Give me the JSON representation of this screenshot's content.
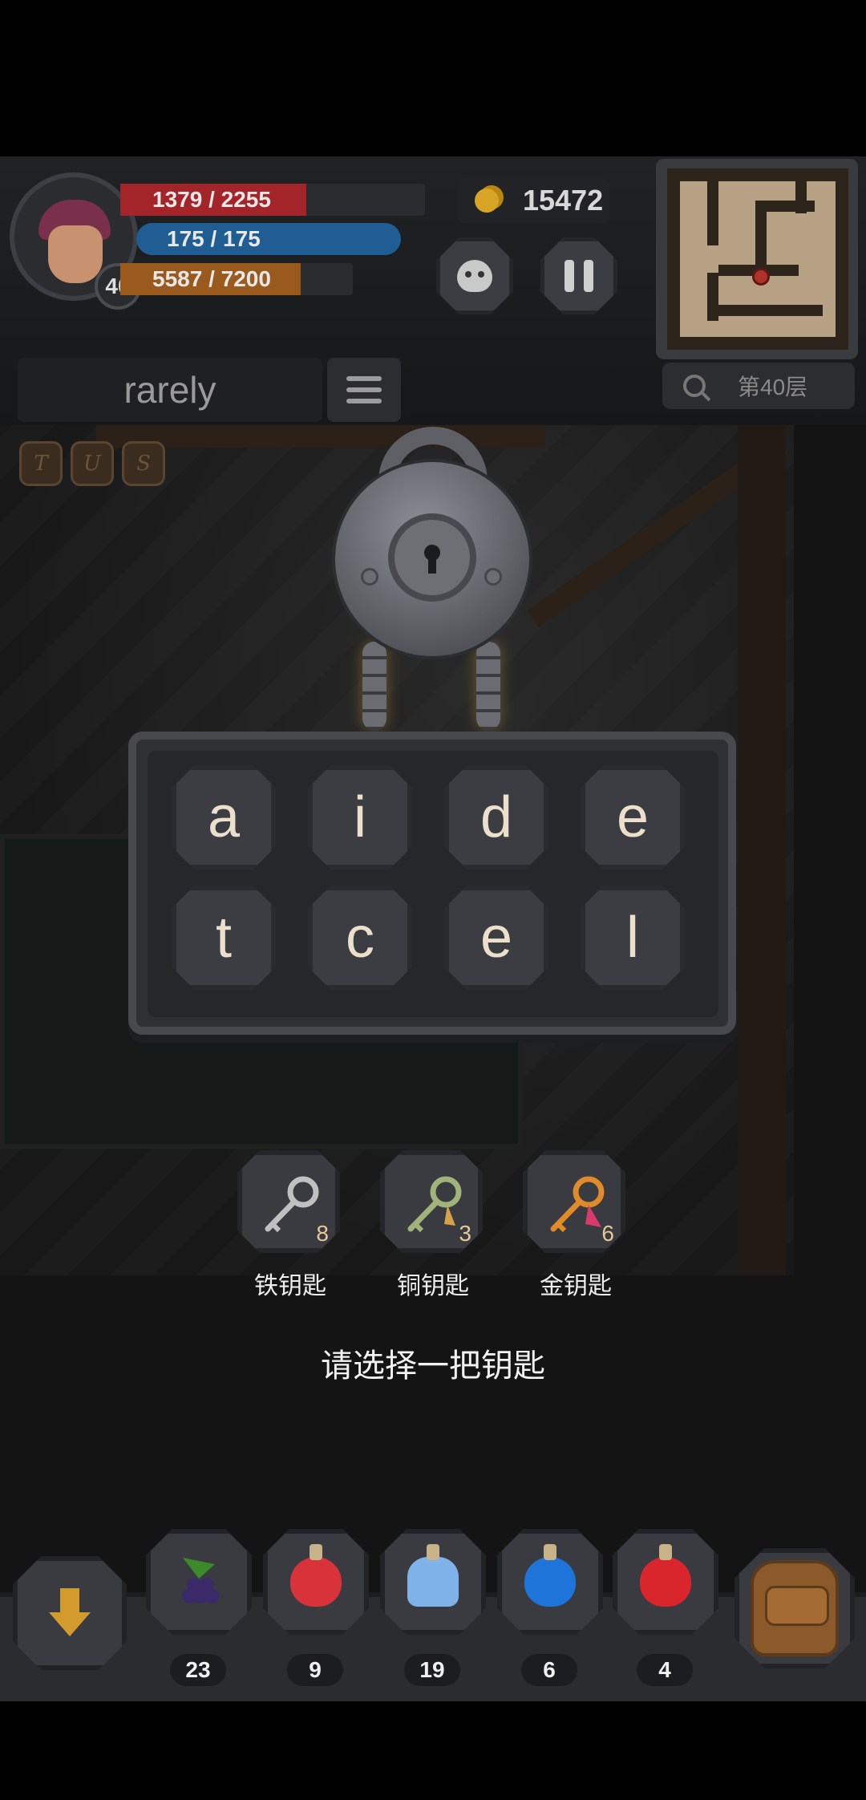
{
  "hud": {
    "hp_text": "1379 / 2255",
    "hp_fraction": 0.6115,
    "mp_text": "175 / 175",
    "mp_fraction": 1.0,
    "xp_text": "5587 / 7200",
    "xp_fraction": 0.776,
    "level": "40",
    "coins": "15472",
    "floor": "第40层"
  },
  "word": {
    "current": "rarely"
  },
  "runes": [
    "T",
    "U",
    "S"
  ],
  "lock_panel": {
    "row1": [
      "a",
      "i",
      "d",
      "e"
    ],
    "row2": [
      "t",
      "c",
      "e",
      "l"
    ]
  },
  "keys": [
    {
      "name": "铁钥匙",
      "count": "8",
      "color": "#c0c0c0"
    },
    {
      "name": "铜钥匙",
      "count": "3",
      "color": "#9fb37a"
    },
    {
      "name": "金钥匙",
      "count": "6",
      "color": "#e08a2a"
    }
  ],
  "prompt": "请选择一把钥匙",
  "inventory": [
    {
      "icon": "grape-icon",
      "count": "23"
    },
    {
      "icon": "red-potion-icon",
      "count": "9"
    },
    {
      "icon": "blue-vial-icon",
      "count": "19"
    },
    {
      "icon": "blue-flask-icon",
      "count": "6"
    },
    {
      "icon": "red-flask-icon",
      "count": "4"
    }
  ],
  "colors": {
    "hp": "#a3252a",
    "mp": "#1f5d93",
    "xp": "#9a5a1e",
    "coin": "#d7a425",
    "tile_text": "#ece0cc"
  }
}
